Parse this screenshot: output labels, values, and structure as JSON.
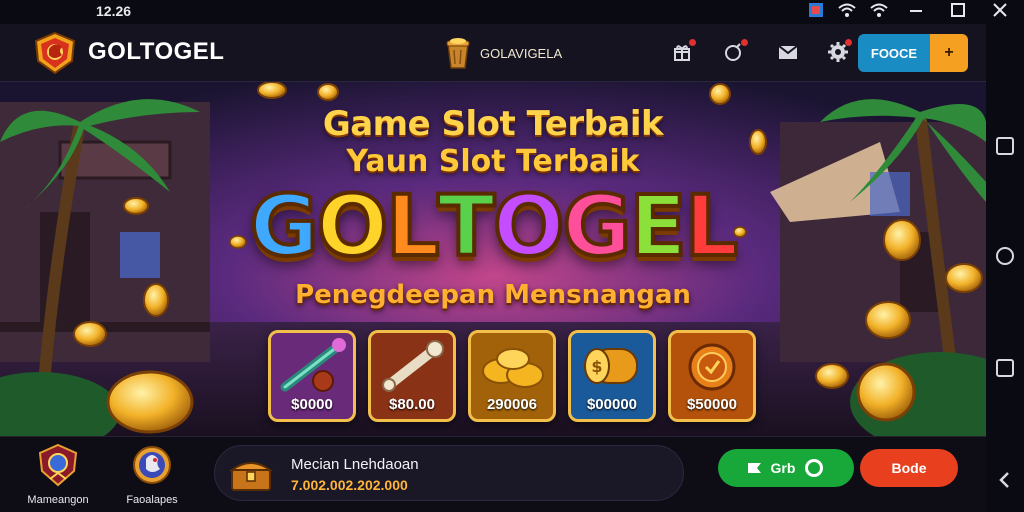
{
  "status_bar": {
    "time": "12.26",
    "icons": [
      "app-thumbnail-icon",
      "wifi-icon",
      "wifi-icon",
      "minimize-icon",
      "maximize-icon",
      "close-icon"
    ]
  },
  "header": {
    "brand": "GOLTOGEL",
    "center_label": "GOLAVIGELA",
    "icons": [
      "gift-icon",
      "bomb-icon",
      "mail-icon",
      "gear-icon"
    ],
    "action_button": {
      "label": "FOOCE",
      "plus": "+"
    }
  },
  "banner": {
    "title_line1": "Game Slot Terbaik",
    "title_line2": "Yaun Slot Terbaik",
    "big_word": [
      "G",
      "O",
      "L",
      "T",
      "O",
      "G",
      "E",
      "L"
    ],
    "big_word_colors": [
      "#3fa8ff",
      "#ffd42a",
      "#ff8a1e",
      "#5ad14a",
      "#c34dff",
      "#ff4f9a",
      "#8be03a",
      "#ff3b3b"
    ],
    "subtitle": "Penegdeepan Mensnangan",
    "cards": [
      {
        "price": "$0000",
        "icon": "staff-icon",
        "color": "#6a2a7a"
      },
      {
        "price": "$80.00",
        "icon": "wrench-icon",
        "color": "#8a3216"
      },
      {
        "price": "290006",
        "icon": "gold-coins-icon",
        "color": "#a2620a"
      },
      {
        "price": "$00000",
        "icon": "coin-roll-icon",
        "color": "#1a5a9a"
      },
      {
        "price": "$50000",
        "icon": "medal-coin-icon",
        "color": "#b4520c"
      }
    ]
  },
  "footer": {
    "left_items": [
      {
        "label": "Mameangon",
        "icon": "shield-emblem-icon"
      },
      {
        "label": "Faoalapes",
        "icon": "rooster-emblem-icon"
      }
    ],
    "ticker": {
      "title": "Mecian Lnehdaoan",
      "amount": "7.002.002.202.000"
    },
    "buttons": [
      {
        "label": "Grb",
        "color": "#18a83a"
      },
      {
        "label": "Bode",
        "color": "#e8401e"
      }
    ]
  },
  "nav_rail": {
    "icons": [
      "square-icon",
      "circle-icon",
      "square-icon",
      "back-chevron-icon"
    ]
  }
}
